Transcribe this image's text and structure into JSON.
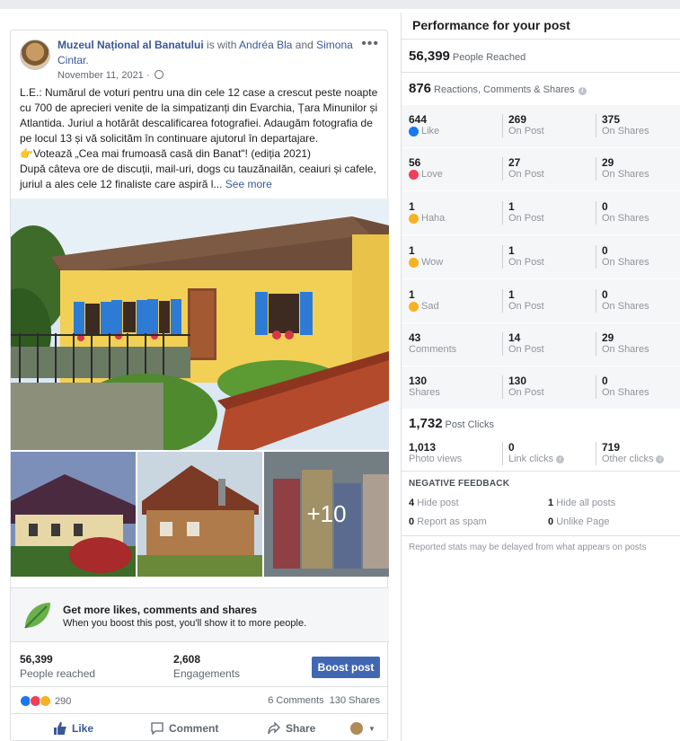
{
  "post": {
    "page_name": "Muzeul Național al Banatului",
    "is_with": "is with",
    "person1": "Andréa Bla",
    "and_word": "and",
    "person2": "Simona Cintar.",
    "date": "November 11, 2021 ·",
    "more_dots": "•••",
    "body_line1": "L.E.: Numărul de voturi pentru una din cele 12 case a crescut peste noapte cu 700 de aprecieri venite de la simpatizanți din Evarchia, Țara Minunilor și Atlantida. Juriul a hotărât descalificarea fotografiei. Adaugăm fotografia de pe locul 13 și vă solicităm în continuare ajutorul în departajare.",
    "body_line2": "👉Votează „Cea mai frumoasă casă din Banat\"! (ediția 2021)",
    "body_line3": "După câteva ore de discuții, mail-uri, dogs cu tauzănailăn, ceaiuri și cafele, juriul a ales cele 12 finaliste care aspiră l...",
    "see_more": "See more",
    "plus_more": "+10"
  },
  "boost": {
    "title": "Get more likes, comments and shares",
    "subtitle": "When you boost this post, you'll show it to more people."
  },
  "stats": {
    "reached_value": "56,399",
    "reached_label": "People reached",
    "engagements_value": "2,608",
    "engagements_label": "Engagements",
    "boost_button": "Boost post"
  },
  "reactions": {
    "count": "290",
    "comments": "6 Comments",
    "shares": "130 Shares"
  },
  "actions": {
    "like": "Like",
    "comment": "Comment",
    "share": "Share"
  },
  "panel": {
    "title": "Performance for your post",
    "people_reached_value": "56,399",
    "people_reached_label": "People Reached",
    "rcs_value": "876",
    "rcs_label": "Reactions, Comments & Shares",
    "rows": [
      {
        "total": "644",
        "label": "Like",
        "on_post": "269",
        "on_shares": "375"
      },
      {
        "total": "56",
        "label": "Love",
        "on_post": "27",
        "on_shares": "29"
      },
      {
        "total": "1",
        "label": "Haha",
        "on_post": "1",
        "on_shares": "0"
      },
      {
        "total": "1",
        "label": "Wow",
        "on_post": "1",
        "on_shares": "0"
      },
      {
        "total": "1",
        "label": "Sad",
        "on_post": "1",
        "on_shares": "0"
      },
      {
        "total": "43",
        "label": "Comments",
        "on_post": "14",
        "on_shares": "29"
      },
      {
        "total": "130",
        "label": "Shares",
        "on_post": "130",
        "on_shares": "0"
      }
    ],
    "on_post_label": "On Post",
    "on_shares_label": "On Shares",
    "post_clicks_value": "1,732",
    "post_clicks_label": "Post Clicks",
    "photo_views_value": "1,013",
    "photo_views_label": "Photo views",
    "link_clicks_value": "0",
    "link_clicks_label": "Link clicks",
    "other_clicks_value": "719",
    "other_clicks_label": "Other clicks",
    "negative_title": "NEGATIVE FEEDBACK",
    "hide_post_value": "4",
    "hide_post_label": "Hide post",
    "hide_all_value": "1",
    "hide_all_label": "Hide all posts",
    "spam_value": "0",
    "spam_label": "Report as spam",
    "unlike_value": "0",
    "unlike_label": "Unlike Page",
    "note": "Reported stats may be delayed from what appears on posts"
  },
  "colors": {
    "accent": "#4267b2",
    "link": "#385898",
    "like": "#1877f2",
    "love": "#f33e58",
    "haha": "#f7b125"
  }
}
